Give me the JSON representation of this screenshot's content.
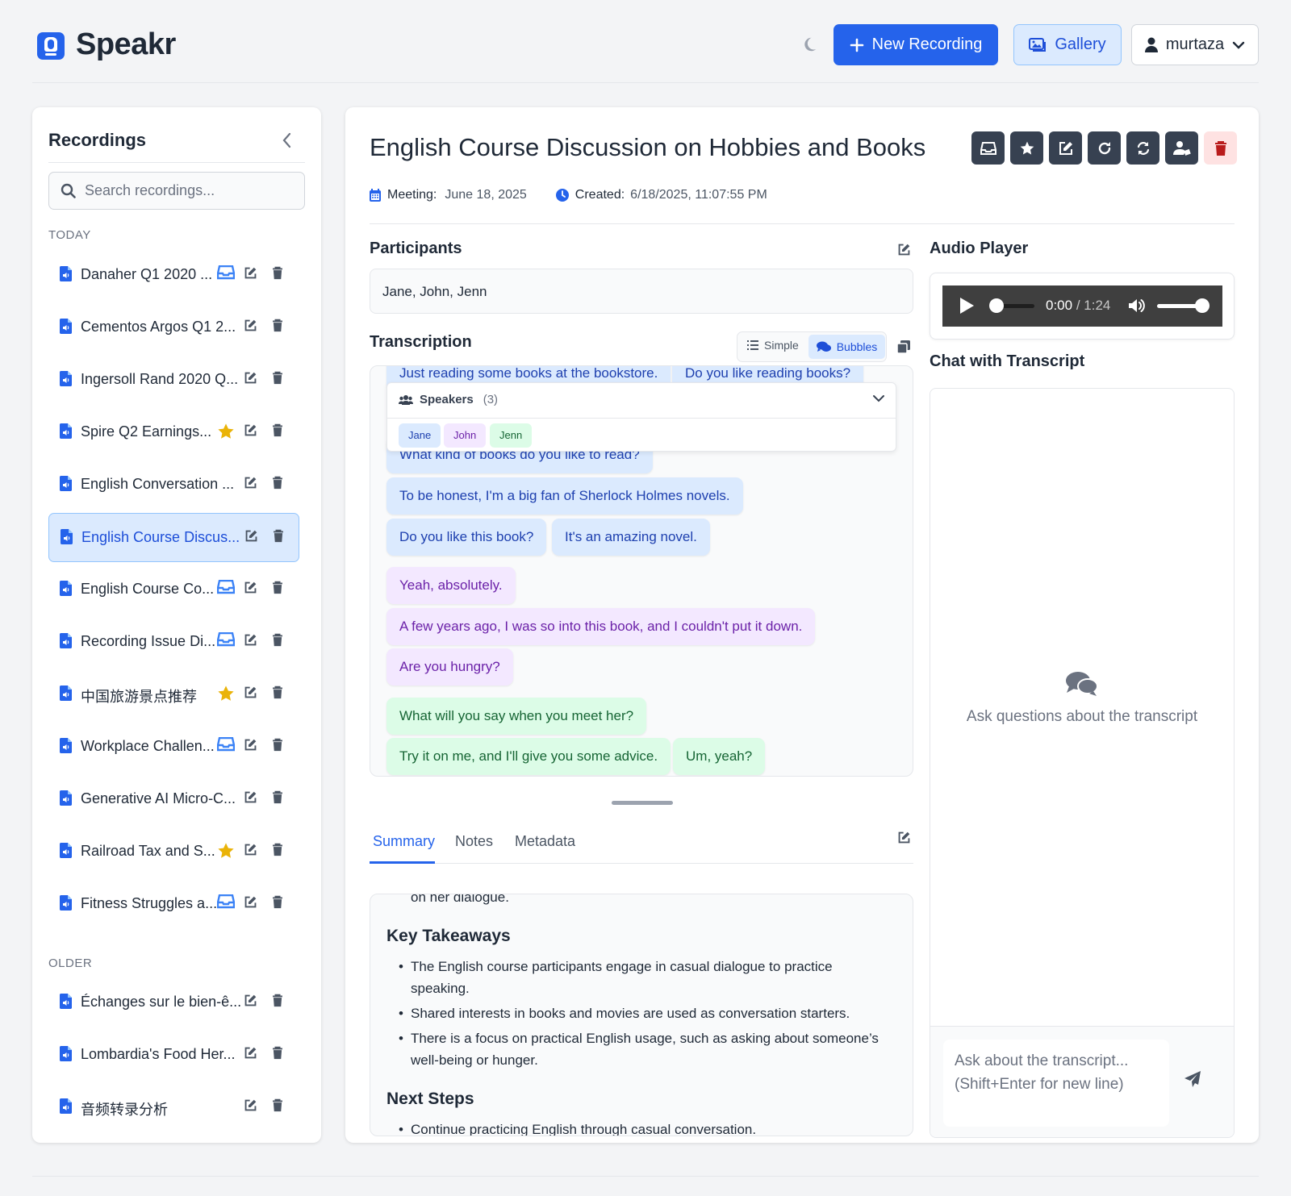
{
  "header": {
    "app_name": "Speakr",
    "new_recording_label": "New Recording",
    "gallery_label": "Gallery",
    "username": "murtaza",
    "accent_color": "#2563eb"
  },
  "sidebar": {
    "title": "Recordings",
    "search_placeholder": "Search recordings...",
    "today_label": "TODAY",
    "older_label": "OLDER",
    "today_items": [
      {
        "name": "Danaher Q1 2020 ...",
        "badge": "inbox-icon"
      },
      {
        "name": "Cementos Argos Q1 2...",
        "badge": ""
      },
      {
        "name": "Ingersoll Rand 2020 Q...",
        "badge": ""
      },
      {
        "name": "Spire Q2 Earnings...",
        "badge": "star-icon"
      },
      {
        "name": "English Conversation ...",
        "badge": ""
      },
      {
        "name": "English Course Discus...",
        "badge": "",
        "active": true
      },
      {
        "name": "English Course Co...",
        "badge": "inbox-icon"
      },
      {
        "name": "Recording Issue Di...",
        "badge": "inbox-icon"
      },
      {
        "name": "中国旅游景点推荐",
        "badge": "star-icon"
      },
      {
        "name": "Workplace Challen...",
        "badge": "inbox-icon"
      },
      {
        "name": "Generative AI Micro-C...",
        "badge": ""
      },
      {
        "name": "Railroad Tax and S...",
        "badge": "star-icon"
      },
      {
        "name": "Fitness Struggles a...",
        "badge": "inbox-icon"
      }
    ],
    "older_items": [
      {
        "name": "Échanges sur le bien-ê...",
        "badge": ""
      },
      {
        "name": "Lombardia's Food Her...",
        "badge": ""
      },
      {
        "name": "音频转录分析",
        "badge": ""
      }
    ]
  },
  "recording": {
    "title": "English Course Discussion on Hobbies and Books",
    "meeting_label": "Meeting:",
    "meeting_date": "June 18, 2025",
    "created_label": "Created:",
    "created_value": "6/18/2025, 11:07:55 PM"
  },
  "participants": {
    "heading": "Participants",
    "value": "Jane, John, Jenn"
  },
  "transcription": {
    "heading": "Transcription",
    "simple_label": "Simple",
    "bubbles_label": "Bubbles",
    "speakers_label": "Speakers",
    "speakers_count": "(3)",
    "speakers": [
      {
        "name": "Jane",
        "color": "#dbeafe",
        "text_color": "#1e40af"
      },
      {
        "name": "John",
        "color": "#f3e8ff",
        "text_color": "#6b21a8"
      },
      {
        "name": "Jenn",
        "color": "#dcfce7",
        "text_color": "#166534"
      }
    ],
    "bubbles": [
      {
        "text": "Just reading some books at the bookstore.",
        "speaker": "jane"
      },
      {
        "text": "Do you like reading books?",
        "speaker": "jane"
      },
      {
        "text": "What kind of books do you like to read?",
        "speaker": "jane"
      },
      {
        "text": "To be honest, I'm a big fan of Sherlock Holmes novels.",
        "speaker": "jane"
      },
      {
        "text": "Do you like this book?",
        "speaker": "jane"
      },
      {
        "text": "It's an amazing novel.",
        "speaker": "jane"
      },
      {
        "text": "Yeah, absolutely.",
        "speaker": "john"
      },
      {
        "text": "A few years ago, I was so into this book, and I couldn't put it down.",
        "speaker": "john"
      },
      {
        "text": "Are you hungry?",
        "speaker": "john"
      },
      {
        "text": "What will you say when you meet her?",
        "speaker": "jenn"
      },
      {
        "text": "Try it on me, and I'll give you some advice.",
        "speaker": "jenn"
      },
      {
        "text": "Um, yeah?",
        "speaker": "jenn"
      }
    ]
  },
  "tabs": {
    "summary": "Summary",
    "notes": "Notes",
    "metadata": "Metadata"
  },
  "summary": {
    "fragment": "on her dialogue.",
    "key_takeaways_heading": "Key Takeaways",
    "key_takeaways": [
      "The English course participants engage in casual dialogue to practice speaking.",
      "Shared interests in books and movies are used as conversation starters.",
      "There is a focus on practical English usage, such as asking about someone’s well-being or hunger."
    ],
    "next_steps_heading": "Next Steps",
    "next_steps": [
      "Continue practicing English through casual conversation."
    ]
  },
  "audio_player": {
    "heading": "Audio Player",
    "current_time": "0:00",
    "duration": "/ 1:24",
    "progress": 0,
    "volume": 1.0
  },
  "chat": {
    "heading": "Chat with Transcript",
    "empty_text": "Ask questions about the transcript",
    "input_placeholder": "Ask about the transcript...\n(Shift+Enter for new line)"
  }
}
